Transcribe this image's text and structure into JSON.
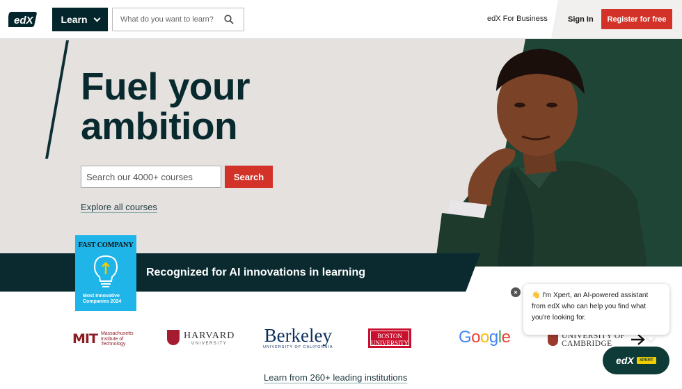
{
  "header": {
    "logo_text": "edX",
    "learn_label": "Learn",
    "search_placeholder": "What do you want to learn?",
    "business_link": "edX For Business",
    "signin_label": "Sign In",
    "register_label": "Register for free"
  },
  "hero": {
    "headline_line1": "Fuel your",
    "headline_line2": "ambition",
    "search_placeholder": "Search our 4000+ courses",
    "search_button": "Search",
    "explore_link": "Explore all courses"
  },
  "banner": {
    "badge_title": "FAST COMPANY",
    "badge_subtitle": "Most Innovative Companies 2024",
    "text": "Recognized for AI innovations in learning"
  },
  "institutions": [
    {
      "mark": "MIT",
      "name": "Massachusetts Institute of Technology"
    },
    {
      "name": "HARVARD",
      "sub": "UNIVERSITY"
    },
    {
      "name": "Berkeley",
      "sub": "UNIVERSITY OF CALIFORNIA"
    },
    {
      "name": "BOSTON UNIVERSITY"
    },
    {
      "name": "Google"
    },
    {
      "name": "UNIVERSITY OF CAMBRIDGE"
    }
  ],
  "learn_from_link": "Learn from 260+ leading institutions",
  "chat": {
    "emoji": "👋",
    "message": "I'm Xpert, an AI-powered assistant from edX who can help you find what you're looking for.",
    "close_glyph": "×",
    "button_text": "edX",
    "button_tag": "XPERT"
  },
  "colors": {
    "brand_dark": "#02262b",
    "accent_red": "#d23228",
    "hero_bg": "#e5e1de",
    "hero_green": "#1e4536",
    "fast_company_blue": "#1fb5e8"
  }
}
